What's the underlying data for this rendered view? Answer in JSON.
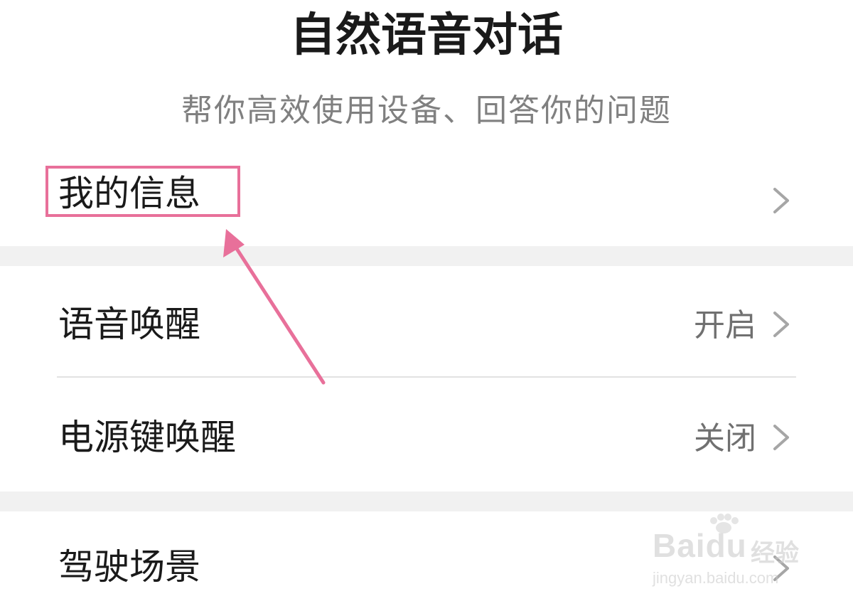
{
  "header": {
    "title": "自然语音对话",
    "subtitle": "帮你高效使用设备、回答你的问题"
  },
  "settings": {
    "my_info": {
      "label": "我的信息"
    },
    "voice_wake": {
      "label": "语音唤醒",
      "value": "开启"
    },
    "power_key_wake": {
      "label": "电源键唤醒",
      "value": "关闭"
    },
    "driving_scene": {
      "label": "驾驶场景"
    }
  },
  "annotation": {
    "color": "#e8709a"
  },
  "watermark": {
    "brand": "Baidu",
    "brand_cn": "经验",
    "url": "jingyan.baidu.com"
  },
  "icons": {
    "chevron": "chevron-right-icon"
  }
}
